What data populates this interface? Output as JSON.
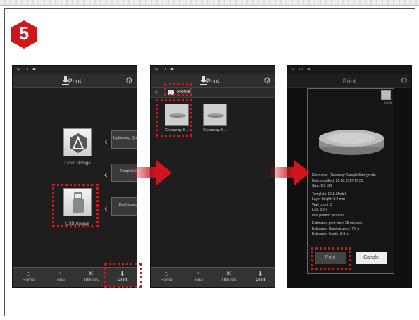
{
  "step": {
    "number": "5",
    "badge_color": "#d0151c"
  },
  "accent_color": "#d0151c",
  "status_bar": {
    "icons": "ᯤ ◘ ⏶"
  },
  "screen1": {
    "title": "Print",
    "settings_icon": "gear-icon",
    "cloud_storage_label": "Cloud storage",
    "usb_storage_label": "USB storage",
    "side_buttons": [
      {
        "label": "Uploading Queue"
      },
      {
        "label": "Temp List"
      },
      {
        "label": "Dashboard"
      }
    ],
    "tabs": [
      {
        "label": "Home",
        "icon": "home-icon"
      },
      {
        "label": "Tune",
        "icon": "tune-icon"
      },
      {
        "label": "Utilities",
        "icon": "utilities-icon"
      },
      {
        "label": "Print",
        "icon": "print-icon"
      }
    ]
  },
  "screen2": {
    "title": "Print",
    "breadcrumb": "Home",
    "files": [
      {
        "label": "Giveaway S..."
      },
      {
        "label": "Giveaway S..."
      }
    ],
    "tabs": [
      {
        "label": "Home",
        "icon": "home-icon"
      },
      {
        "label": "Tune",
        "icon": "tune-icon"
      },
      {
        "label": "Utilities",
        "icon": "utilities-icon"
      },
      {
        "label": "Print",
        "icon": "print-icon"
      }
    ]
  },
  "screen3": {
    "title": "Print",
    "delete_label": "Delete",
    "info_lines": [
      "File name: Giveaway Sample Part.gcode",
      "Date modified: 21.08.2017 17:31",
      "Size: 2.9 MB",
      "",
      "Template: PLA-Model",
      "Layer height: 0.2 mm",
      "Wall count: 3",
      "Infill: 15%",
      "Infill pattern: Normal",
      "",
      "Estimated print time: 35 minutes",
      "Estimated filament used: 7.0 g",
      "Estimated length: 2.4 m"
    ],
    "print_button": "Print",
    "cancel_button": "Cancle"
  }
}
